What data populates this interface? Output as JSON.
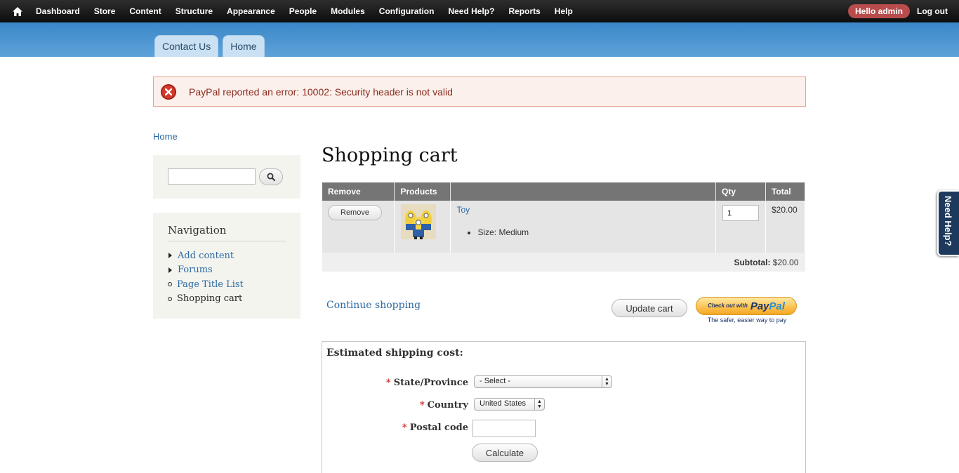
{
  "toolbar": {
    "items": [
      "Dashboard",
      "Store",
      "Content",
      "Structure",
      "Appearance",
      "People",
      "Modules",
      "Configuration",
      "Need Help?",
      "Reports",
      "Help"
    ],
    "hello": "Hello admin",
    "logout": "Log out"
  },
  "tabs": [
    "Contact Us",
    "Home"
  ],
  "error": {
    "message": "PayPal reported an error: 10002: Security header is not valid",
    "color": "#d43a2c"
  },
  "breadcrumb": "Home",
  "search": {
    "value": ""
  },
  "navigation": {
    "title": "Navigation",
    "items": [
      "Add content",
      "Forums",
      "Page Title List",
      "Shopping cart"
    ]
  },
  "page_title": "Shopping cart",
  "cart": {
    "headers": [
      "Remove",
      "Products",
      "",
      "Qty",
      "Total"
    ],
    "rows": [
      {
        "remove_label": "Remove",
        "product": "Toy",
        "attribute": "Size: Medium",
        "qty": "1",
        "total": "$20.00"
      }
    ],
    "subtotal_label": "Subtotal:",
    "subtotal_value": "$20.00"
  },
  "actions": {
    "continue": "Continue shopping",
    "update": "Update cart",
    "paypal_small": "Check out with",
    "paypal_pay": "Pay",
    "paypal_pal": "Pal",
    "paypal_tagline": "The safer, easier way to pay"
  },
  "shipping": {
    "title": "Estimated shipping cost:",
    "state_label": "State/Province",
    "state_value": "- Select -",
    "country_label": "Country",
    "country_value": "United States",
    "postal_label": "Postal code",
    "postal_value": "",
    "calculate": "Calculate"
  },
  "need_help_tab": "Need Help?",
  "colors": {
    "header_blue": "#5a9ed4",
    "link": "#2b6aa3",
    "hello_badge": "#b84c4c"
  }
}
